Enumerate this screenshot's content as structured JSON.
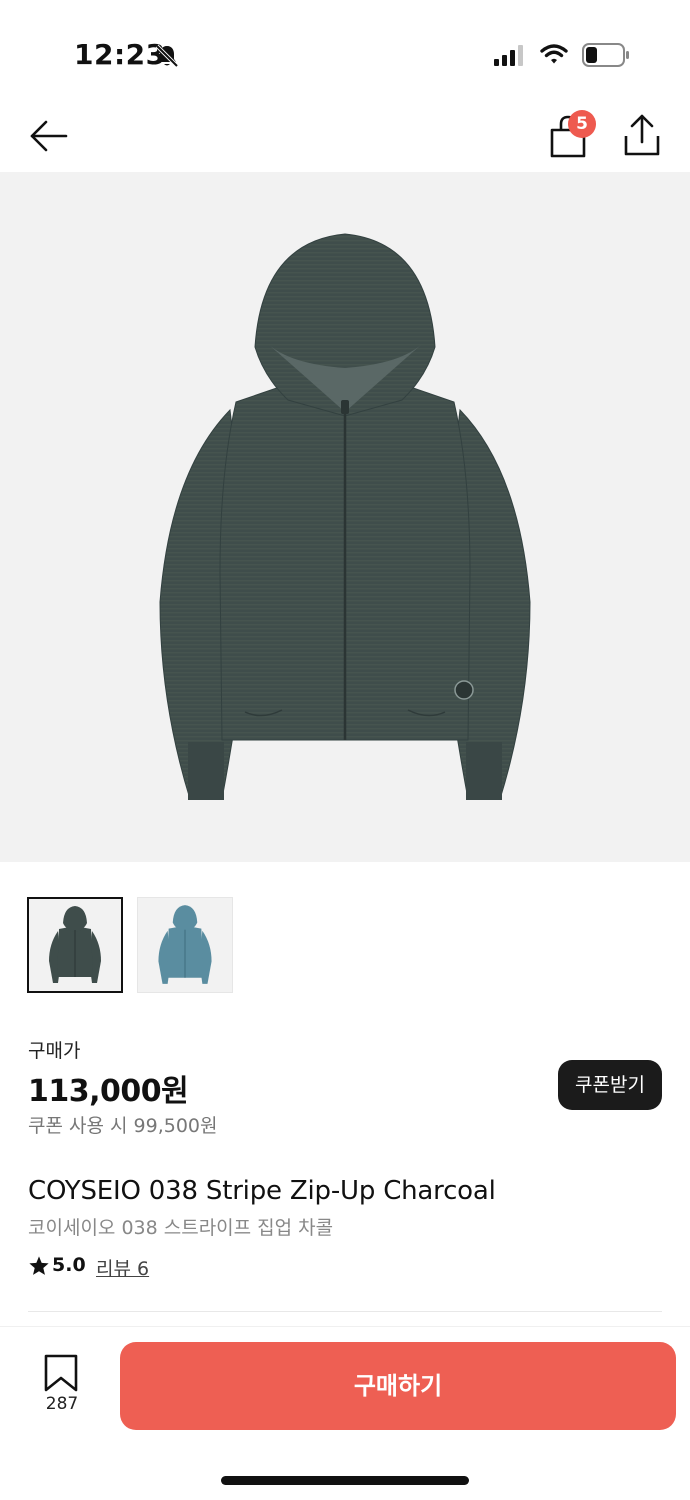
{
  "status_bar": {
    "time": "12:23"
  },
  "nav": {
    "cart_count": "5",
    "back_icon": "arrow-left-icon",
    "cart_icon": "shopping-bag-icon",
    "share_icon": "share-icon"
  },
  "price": {
    "label": "구매가",
    "value": "113,000원",
    "coupon_price": "쿠폰 사용 시 99,500원",
    "coupon_button": "쿠폰받기"
  },
  "product": {
    "name_en": "COYSEIO 038 Stripe Zip-Up Charcoal",
    "name_ko": "코이세이오 038 스트라이프 집업 차콜",
    "rating": "5.0",
    "review_label": "리뷰 6"
  },
  "thumbnails": [
    {
      "color": "#3f4d4b",
      "selected": true
    },
    {
      "color": "#5a8da0",
      "selected": false
    }
  ],
  "bottom": {
    "bookmark_count": "287",
    "buy_button": "구매하기"
  },
  "colors": {
    "accent": "#ee5f53",
    "badge": "#ee5a4f",
    "coupon_button": "#1b1b1b",
    "hoodie_charcoal": "#3f4d4b",
    "hoodie_blue": "#5a8da0"
  }
}
